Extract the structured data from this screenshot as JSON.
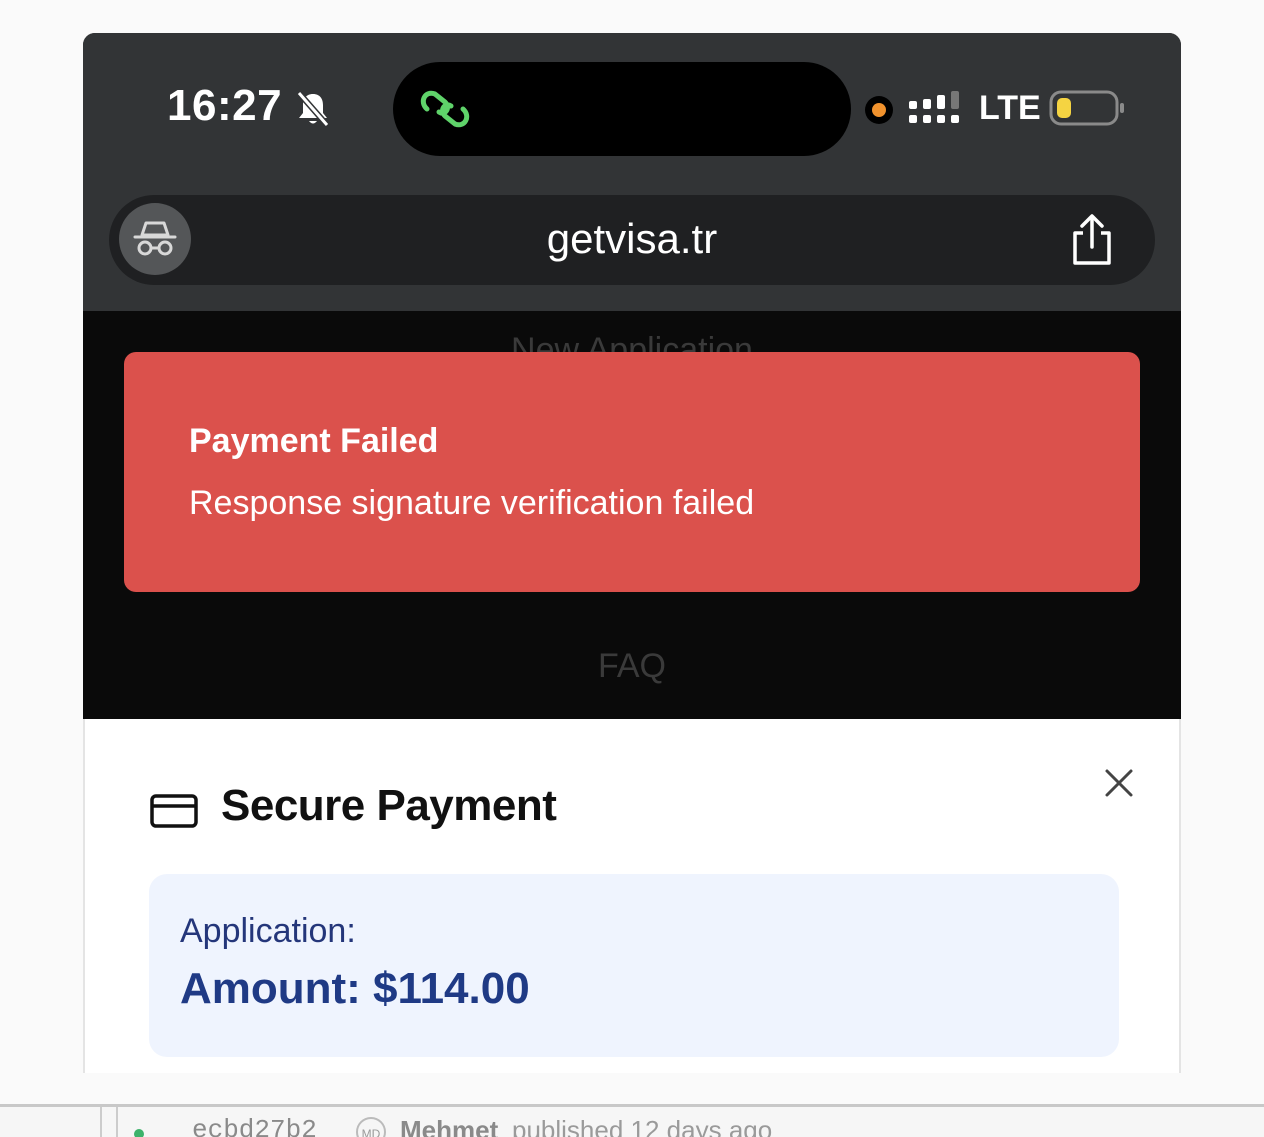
{
  "status_bar": {
    "time": "16:27",
    "bell_icon": "bell-slash-icon",
    "network": "LTE",
    "island_icon": "link-chain-icon",
    "recording_color": "#f0922d",
    "battery_color": "#f5d442"
  },
  "browser": {
    "url": "getvisa.tr",
    "left_icon": "incognito-icon",
    "right_icon": "share-icon"
  },
  "page": {
    "nav_behind_top": "New Application",
    "nav_behind_bottom": "FAQ"
  },
  "toast": {
    "title": "Payment Failed",
    "message": "Response signature verification failed",
    "color": "#db514c"
  },
  "payment_sheet": {
    "title": "Secure Payment",
    "title_icon": "credit-card-icon",
    "close_icon": "close-icon",
    "application_label": "Application:",
    "amount_label": "Amount: $114.00"
  },
  "background_strip": {
    "commit_hash": "ecbd27b2",
    "avatar_initials": "MD",
    "author": "Mehmet",
    "published": "published 12 days ago"
  }
}
